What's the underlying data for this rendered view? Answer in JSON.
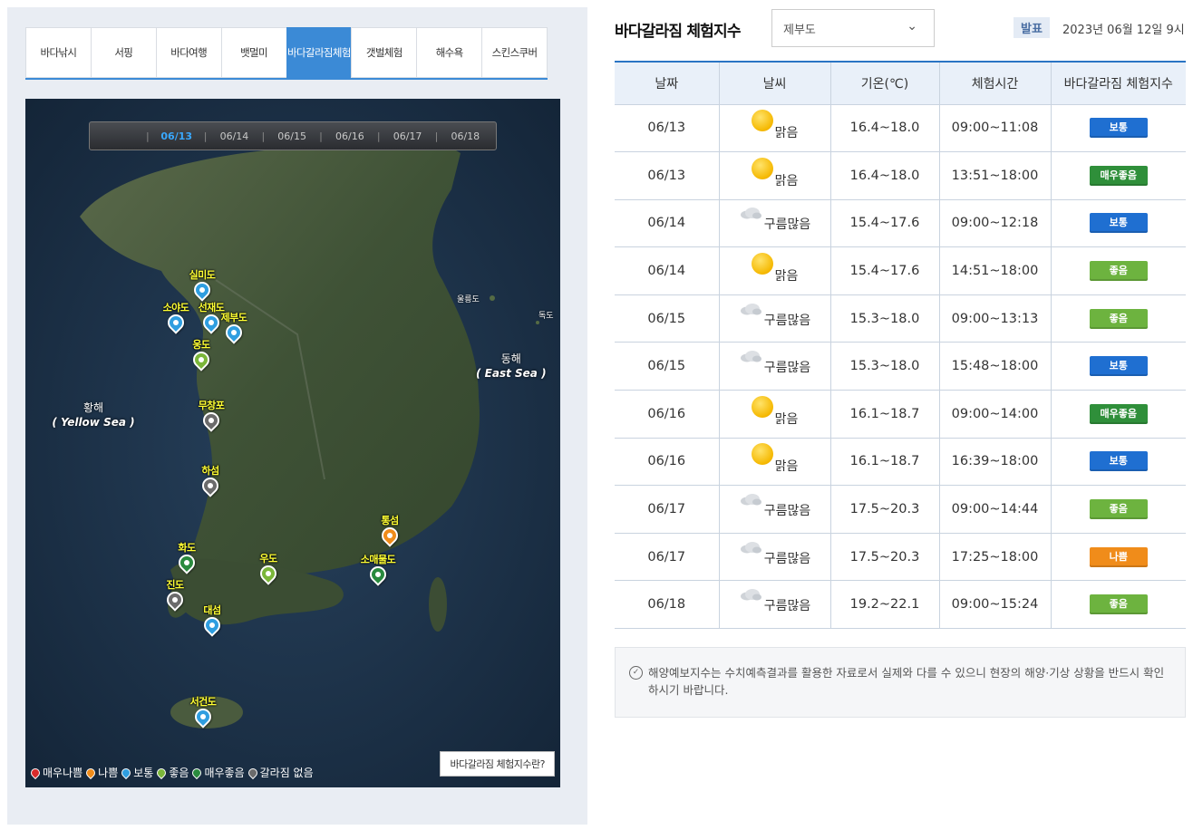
{
  "tabs": [
    {
      "label": "바다낚시",
      "active": false
    },
    {
      "label": "서핑",
      "active": false
    },
    {
      "label": "바다여행",
      "active": false
    },
    {
      "label": "뱃멀미",
      "active": false
    },
    {
      "label": "바다갈라짐체험",
      "active": true
    },
    {
      "label": "갯벌체험",
      "active": false
    },
    {
      "label": "해수욕",
      "active": false
    },
    {
      "label": "스킨스쿠버",
      "active": false
    }
  ],
  "map": {
    "dates": [
      "06/13",
      "06/14",
      "06/15",
      "06/16",
      "06/17",
      "06/18"
    ],
    "active_date": "06/13",
    "yellow_sea": {
      "ko": "황해",
      "en": "( Yellow Sea )"
    },
    "east_sea": {
      "ko": "동해",
      "en": "( East Sea )"
    },
    "islands": {
      "ulleungdo": "울릉도",
      "dokdo": "독도"
    },
    "sites": [
      {
        "name": "실미도",
        "status": "보통"
      },
      {
        "name": "소야도",
        "status": "보통"
      },
      {
        "name": "선재도",
        "status": "보통"
      },
      {
        "name": "제부도",
        "status": "보통"
      },
      {
        "name": "웅도",
        "status": "좋음"
      },
      {
        "name": "무창포",
        "status": "갈라짐 없음"
      },
      {
        "name": "하섬",
        "status": "갈라짐 없음"
      },
      {
        "name": "화도",
        "status": "매우좋음"
      },
      {
        "name": "진도",
        "status": "갈라짐 없음"
      },
      {
        "name": "우도",
        "status": "좋음"
      },
      {
        "name": "대섬",
        "status": "보통"
      },
      {
        "name": "통섬",
        "status": "나쁨"
      },
      {
        "name": "소매물도",
        "status": "매우좋음"
      },
      {
        "name": "서건도",
        "status": "보통"
      }
    ],
    "legend": [
      {
        "label": "매우나쁨",
        "color": "#d92b2b"
      },
      {
        "label": "나쁨",
        "color": "#f08c1a"
      },
      {
        "label": "보통",
        "color": "#2f9ee0"
      },
      {
        "label": "좋음",
        "color": "#7bb63a"
      },
      {
        "label": "매우좋음",
        "color": "#2a8a3e"
      },
      {
        "label": "갈라짐 없음",
        "color": "#6b6b6b"
      }
    ],
    "help_button": "바다갈라짐 체험지수란?"
  },
  "header": {
    "title": "바다갈라짐 체험지수",
    "region": "제부도",
    "published_label": "발표",
    "published_time": "2023년 06월 12일 9시"
  },
  "table": {
    "columns": [
      "날짜",
      "날씨",
      "기온(℃)",
      "체험시간",
      "바다갈라짐 체험지수"
    ],
    "rows": [
      {
        "date": "06/13",
        "weather": "맑음",
        "icon": "sun-icon",
        "temp": "16.4~18.0",
        "time": "09:00~11:08",
        "index": "보통"
      },
      {
        "date": "06/13",
        "weather": "맑음",
        "icon": "sun-icon",
        "temp": "16.4~18.0",
        "time": "13:51~18:00",
        "index": "매우좋음"
      },
      {
        "date": "06/14",
        "weather": "구름많음",
        "icon": "cloud-icon",
        "temp": "15.4~17.6",
        "time": "09:00~12:18",
        "index": "보통"
      },
      {
        "date": "06/14",
        "weather": "맑음",
        "icon": "sun-icon",
        "temp": "15.4~17.6",
        "time": "14:51~18:00",
        "index": "좋음"
      },
      {
        "date": "06/15",
        "weather": "구름많음",
        "icon": "cloud-icon",
        "temp": "15.3~18.0",
        "time": "09:00~13:13",
        "index": "좋음"
      },
      {
        "date": "06/15",
        "weather": "구름많음",
        "icon": "cloud-icon",
        "temp": "15.3~18.0",
        "time": "15:48~18:00",
        "index": "보통"
      },
      {
        "date": "06/16",
        "weather": "맑음",
        "icon": "sun-icon",
        "temp": "16.1~18.7",
        "time": "09:00~14:00",
        "index": "매우좋음"
      },
      {
        "date": "06/16",
        "weather": "맑음",
        "icon": "sun-icon",
        "temp": "16.1~18.7",
        "time": "16:39~18:00",
        "index": "보통"
      },
      {
        "date": "06/17",
        "weather": "구름많음",
        "icon": "cloud-icon",
        "temp": "17.5~20.3",
        "time": "09:00~14:44",
        "index": "좋음"
      },
      {
        "date": "06/17",
        "weather": "구름많음",
        "icon": "cloud-icon",
        "temp": "17.5~20.3",
        "time": "17:25~18:00",
        "index": "나쁨"
      },
      {
        "date": "06/18",
        "weather": "구름많음",
        "icon": "cloud-icon",
        "temp": "19.2~22.1",
        "time": "09:00~15:24",
        "index": "좋음"
      }
    ]
  },
  "index_colors": {
    "매우나쁨": "#d92b2b",
    "나쁨": "#f08c1a",
    "보통": "#1f6fd1",
    "좋음": "#6db33f",
    "매우좋음": "#2f8f3a",
    "갈라짐 없음": "#6b6b6b"
  },
  "notice": "해양예보지수는 수치예측결과를 활용한 자료로서 실제와 다를 수 있으니 현장의 해양·기상 상황을 반드시 확인하시기 바랍니다."
}
